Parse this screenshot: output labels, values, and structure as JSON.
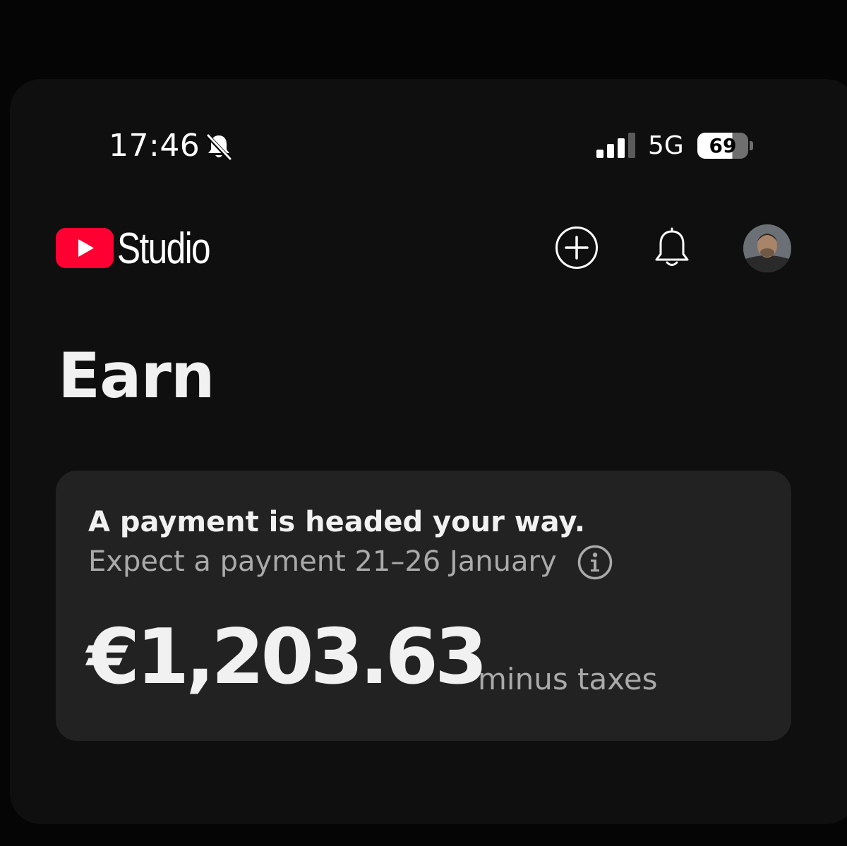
{
  "status_bar": {
    "time": "17:46",
    "network": "5G",
    "battery": "69",
    "icons": [
      "bell-muted-icon",
      "signal-icon",
      "battery-icon"
    ]
  },
  "header": {
    "app_name": "Studio",
    "brand_color": "#ff0033",
    "icons": [
      "youtube-logo-icon",
      "create-plus-icon",
      "notification-bell-icon",
      "avatar"
    ]
  },
  "page": {
    "title": "Earn"
  },
  "payment_card": {
    "heading": "A payment is headed your way.",
    "subtitle": "Expect a payment 21–26 January",
    "amount": "€1,203.63",
    "amount_note": "minus taxes",
    "icons": [
      "info-icon"
    ]
  }
}
